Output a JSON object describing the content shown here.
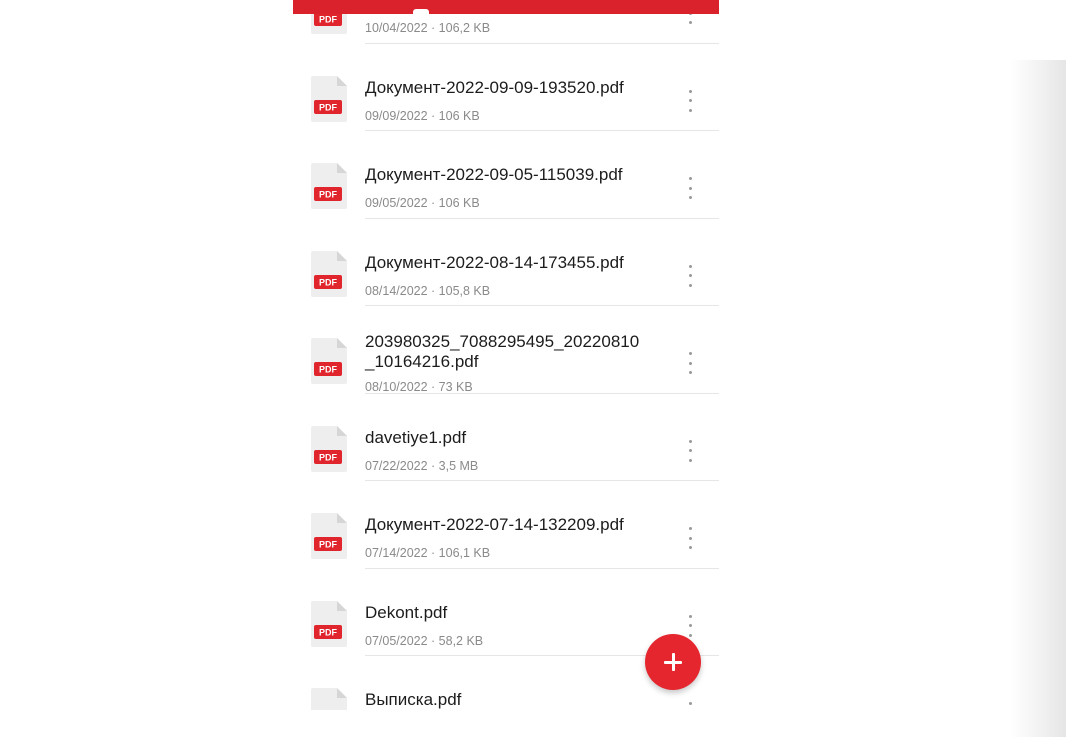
{
  "files": [
    {
      "name": "",
      "meta": "10/04/2022 · 106,2 KB"
    },
    {
      "name": "Документ-2022-09-09-193520.pdf",
      "meta": "09/09/2022 · 106 KB"
    },
    {
      "name": "Документ-2022-09-05-115039.pdf",
      "meta": "09/05/2022 · 106 KB"
    },
    {
      "name": "Документ-2022-08-14-173455.pdf",
      "meta": "08/14/2022 · 105,8 KB"
    },
    {
      "name": "203980325_7088295495_20220810 _10164216.pdf",
      "name_line1": "203980325_7088295495_20220810",
      "name_line2": "_10164216.pdf",
      "meta": "08/10/2022 · 73 KB"
    },
    {
      "name": "davetiye1.pdf",
      "meta": "07/22/2022 · 3,5 MB"
    },
    {
      "name": "Документ-2022-07-14-132209.pdf",
      "meta": "07/14/2022 · 106,1 KB"
    },
    {
      "name": "Dekont.pdf",
      "meta": "07/05/2022 · 58,2 KB"
    },
    {
      "name": "Выписка.pdf",
      "meta": ""
    }
  ],
  "icons": {
    "file_type_label": "PDF",
    "file_icon": "pdf-file-icon",
    "more": "more-vertical-icon",
    "fab": "plus-icon"
  },
  "colors": {
    "accent": "#e5262e",
    "top_bar": "#d9222b",
    "pdf_badge": "#e0252d",
    "file_name": "#1c1c1c",
    "meta_text": "#8a8a8a"
  }
}
